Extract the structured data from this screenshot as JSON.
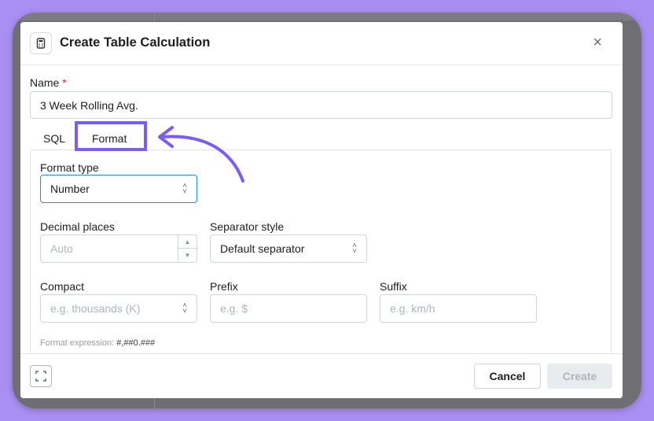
{
  "dialog": {
    "title": "Create Table Calculation",
    "close_glyph": "×"
  },
  "name_field": {
    "label": "Name",
    "required_mark": "*",
    "value": "3 Week Rolling Avg."
  },
  "tabs": [
    {
      "label": "SQL"
    },
    {
      "label": "Format",
      "active": true
    }
  ],
  "format": {
    "format_type": {
      "label": "Format type",
      "value": "Number"
    },
    "decimal_places": {
      "label": "Decimal places",
      "placeholder": "Auto"
    },
    "separator_style": {
      "label": "Separator style",
      "value": "Default separator"
    },
    "compact": {
      "label": "Compact",
      "placeholder": "e.g. thousands (K)"
    },
    "prefix": {
      "label": "Prefix",
      "placeholder": "e.g. $"
    },
    "suffix": {
      "label": "Suffix",
      "placeholder": "e.g. km/h"
    },
    "expression_label": "Format expression:",
    "expression_value": "#,##0.###"
  },
  "footer": {
    "cancel_label": "Cancel",
    "create_label": "Create"
  },
  "colors": {
    "highlight": "#7b5cf5",
    "accent_border": "#228be6",
    "backdrop": "#a98ff2"
  },
  "icons": {
    "header": "calculator-icon",
    "fullscreen": "expand-icon",
    "annotation": "curved-arrow-icon"
  }
}
